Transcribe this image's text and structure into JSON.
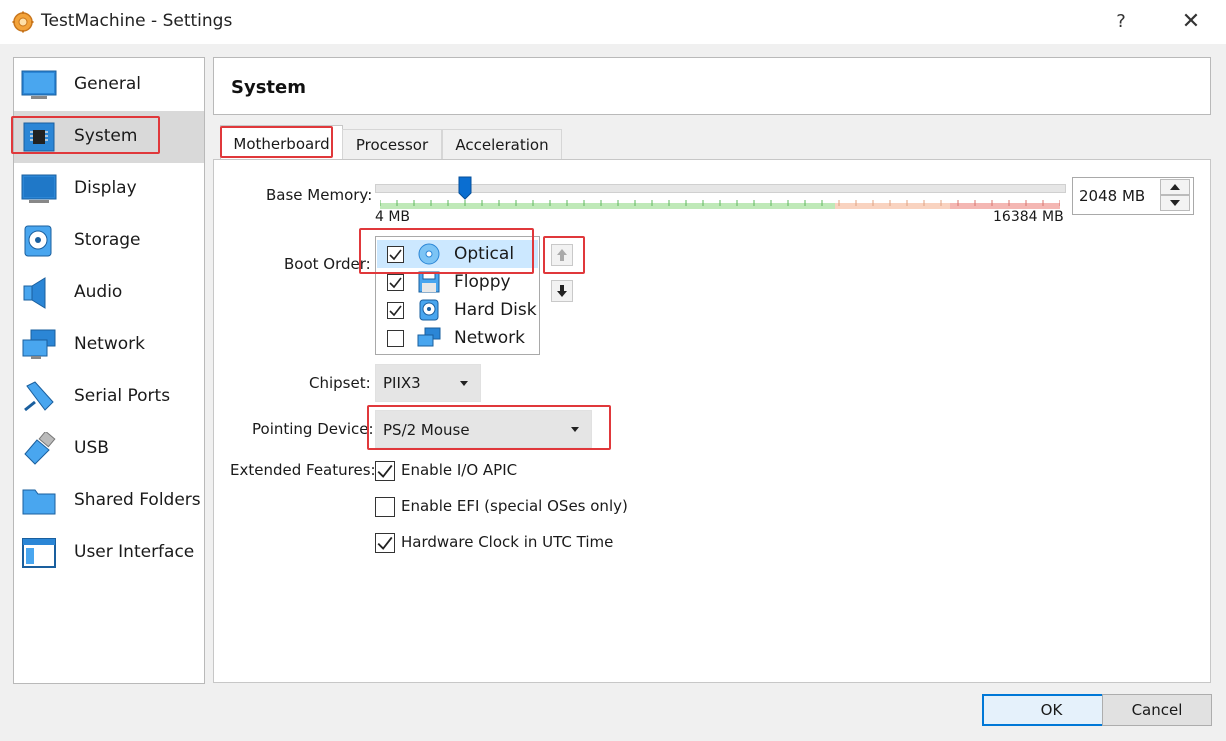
{
  "window": {
    "title": "TestMachine - Settings",
    "help": "?",
    "close": "✕"
  },
  "sidebar": {
    "items": [
      {
        "label": "General",
        "icon": "general-icon"
      },
      {
        "label": "System",
        "icon": "system-icon",
        "selected": true
      },
      {
        "label": "Display",
        "icon": "display-icon"
      },
      {
        "label": "Storage",
        "icon": "storage-icon"
      },
      {
        "label": "Audio",
        "icon": "audio-icon"
      },
      {
        "label": "Network",
        "icon": "network-icon"
      },
      {
        "label": "Serial Ports",
        "icon": "serial-ports-icon"
      },
      {
        "label": "USB",
        "icon": "usb-icon"
      },
      {
        "label": "Shared Folders",
        "icon": "shared-folders-icon"
      },
      {
        "label": "User Interface",
        "icon": "user-interface-icon"
      }
    ]
  },
  "page": {
    "title": "System"
  },
  "tabs": [
    {
      "label": "Motherboard",
      "selected": true
    },
    {
      "label": "Processor"
    },
    {
      "label": "Acceleration"
    }
  ],
  "motherboard": {
    "base_memory": {
      "label": "Base Memory:",
      "min_label": "4 MB",
      "max_label": "16384 MB",
      "value": "2048 MB",
      "min_mb": 4,
      "max_mb": 16384,
      "value_mb": 2048
    },
    "boot_order": {
      "label": "Boot Order:",
      "items": [
        {
          "label": "Optical",
          "checked": true,
          "icon": "optical-disc-icon",
          "selected": true
        },
        {
          "label": "Floppy",
          "checked": true,
          "icon": "floppy-icon"
        },
        {
          "label": "Hard Disk",
          "checked": true,
          "icon": "hard-disk-icon"
        },
        {
          "label": "Network",
          "checked": false,
          "icon": "network-icon"
        }
      ]
    },
    "chipset": {
      "label": "Chipset:",
      "value": "PIIX3"
    },
    "pointing_device": {
      "label": "Pointing Device:",
      "value": "PS/2 Mouse"
    },
    "extended_features": {
      "label": "Extended Features:",
      "options": [
        {
          "label": "Enable I/O APIC",
          "checked": true
        },
        {
          "label": "Enable EFI (special OSes only)",
          "checked": false
        },
        {
          "label": "Hardware Clock in UTC Time",
          "checked": true
        }
      ]
    }
  },
  "buttons": {
    "ok": "OK",
    "cancel": "Cancel"
  },
  "colors": {
    "highlight": "#e0383b",
    "selection": "#cce8ff",
    "accent": "#0078d7"
  }
}
